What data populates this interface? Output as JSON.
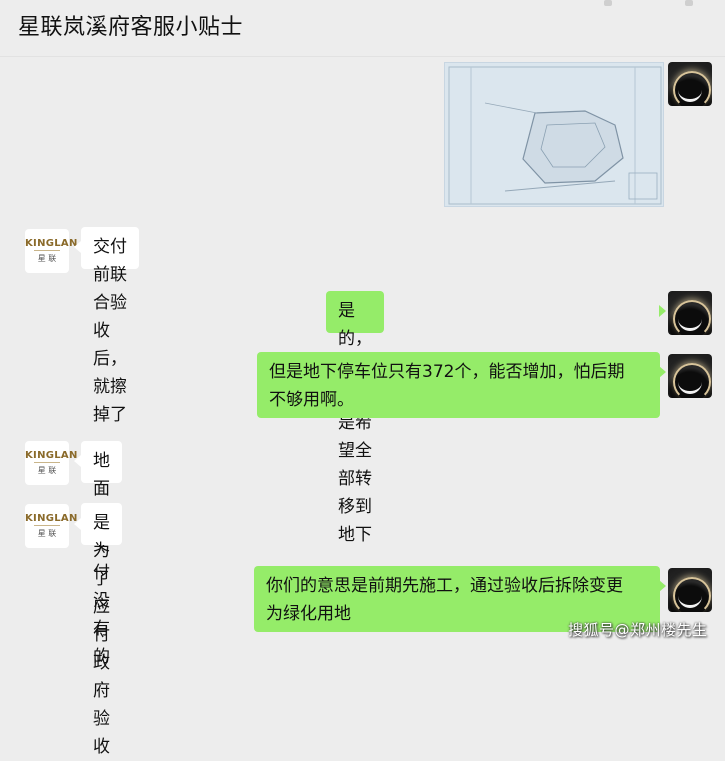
{
  "chat": {
    "title": "星联岚溪府客服小贴士"
  },
  "kinglan_avatar": {
    "brand": "KINGLAN",
    "subtitle": "星 联"
  },
  "messages": [
    {
      "id": "m1",
      "side": "out",
      "type": "image",
      "description": "site-plan"
    },
    {
      "id": "m2",
      "side": "in",
      "text": "交付前联合验收后，就擦掉了"
    },
    {
      "id": "m3",
      "side": "out",
      "text": "是的，所以现在是希望全部转移到地下"
    },
    {
      "id": "m4",
      "side": "out",
      "lines": [
        "但是地下停车位只有372个，能否增加，怕后期",
        "不够用啊。"
      ]
    },
    {
      "id": "m5",
      "side": "in",
      "text": "地面上交付没有的"
    },
    {
      "id": "m6",
      "side": "in",
      "text": "是为了应付政府验收"
    },
    {
      "id": "m7",
      "side": "out",
      "lines": [
        "你们的意思是前期先施工，通过验收后拆除变更",
        "为绿化用地"
      ]
    }
  ],
  "watermark": "搜狐号@郑州楼先生",
  "colors": {
    "background": "#ededed",
    "incoming_bubble": "#ffffff",
    "outgoing_bubble": "#95ec69"
  }
}
